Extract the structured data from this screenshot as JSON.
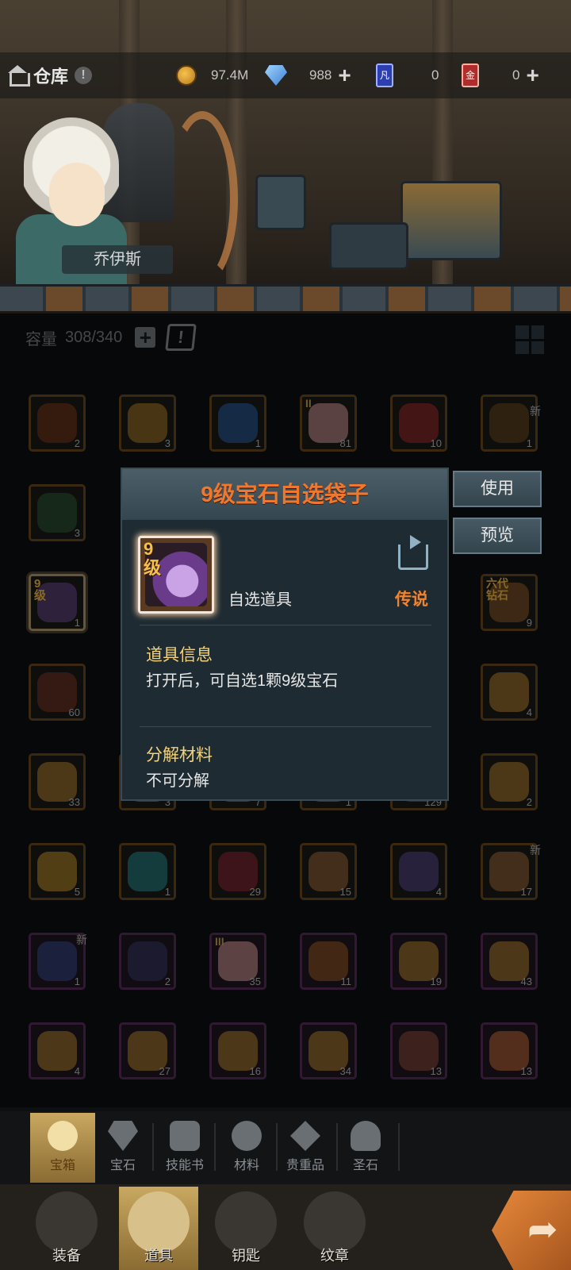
{
  "header": {
    "title": "仓库",
    "gold": "97.4M",
    "gems": "988",
    "blue_cards": "0",
    "red_cards": "0",
    "blue_card_glyph": "凡",
    "red_card_glyph": "金"
  },
  "hero": {
    "name": "乔伊斯"
  },
  "capacity": {
    "label": "容量",
    "value": "308/340"
  },
  "grid": {
    "row1": [
      "2",
      "3",
      "1",
      "81",
      "10",
      "1"
    ],
    "row2": [
      "3",
      "",
      "",
      "",
      "",
      ""
    ],
    "row3": [
      "1",
      "",
      "",
      "",
      "",
      "9"
    ],
    "row4": [
      "60",
      "",
      "",
      "",
      "",
      "4"
    ],
    "row5": [
      "33",
      "3",
      "7",
      "1",
      "129",
      "2"
    ],
    "row6": [
      "5",
      "1",
      "29",
      "15",
      "4",
      "17"
    ],
    "row7": [
      "1",
      "2",
      "35",
      "11",
      "19",
      "43"
    ],
    "row8": [
      "4",
      "27",
      "16",
      "34",
      "13",
      "13"
    ],
    "new_tag": "新",
    "selected_level": "9级",
    "roman_2": "II",
    "roman_3": "III",
    "six_gen": "六代钻石"
  },
  "popup": {
    "title": "9级宝石自选袋子",
    "icon_level": "9级",
    "item_type": "自选道具",
    "rarity": "传说",
    "info_title": "道具信息",
    "info_text": "打开后，可自选1颗9级宝石",
    "decompose_title": "分解材料",
    "decompose_text": "不可分解"
  },
  "actions": {
    "use": "使用",
    "preview": "预览"
  },
  "categories": [
    "宝箱",
    "宝石",
    "技能书",
    "材料",
    "贵重品",
    "圣石"
  ],
  "bottom_nav": [
    "装备",
    "道具",
    "钥匙",
    "纹章"
  ],
  "colors": {
    "accent_orange": "#f0782e",
    "gold_text": "#f3d27a",
    "panel": "#1e2b32"
  }
}
